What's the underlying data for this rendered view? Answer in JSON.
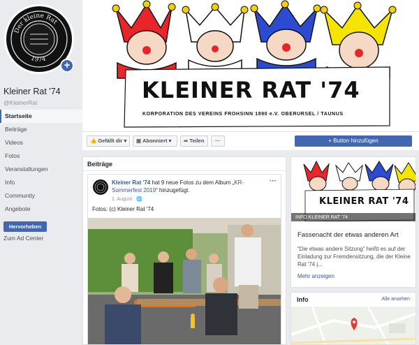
{
  "profile": {
    "name": "Kleiner Rat '74",
    "handle": "@KleinerRat",
    "avatar_text_top": "Der kleine Rat",
    "avatar_text_bottom": "1974"
  },
  "nav": {
    "items": [
      {
        "label": "Startseite",
        "active": true
      },
      {
        "label": "Beiträge"
      },
      {
        "label": "Videos"
      },
      {
        "label": "Fotos"
      },
      {
        "label": "Veranstaltungen"
      },
      {
        "label": "Info"
      },
      {
        "label": "Community"
      },
      {
        "label": "Angebote"
      }
    ],
    "promote_label": "Hervorheben",
    "ad_center_label": "Zum Ad Center"
  },
  "cover": {
    "title": "KLEINER RAT '74",
    "subtitle": "KORPORATION DES VEREINS FROHSINN 1890 e.V. OBERURSEL / TAUNUS"
  },
  "actions": {
    "liked": "Gefällt dir",
    "subscribed": "Abonniert",
    "share": "Teilen",
    "more": "···",
    "add_button": "Button hinzufügen"
  },
  "posts": {
    "header": "Beiträge",
    "post": {
      "author": "Kleiner Rat '74",
      "text_mid": " hat 9 neue Fotos zu dem Album „",
      "album": "KR-Sommerfest 2019",
      "text_end": "“ hinzugefügt.",
      "date": "1. August ·",
      "caption": "Fotos: (c) Kleiner Rat '74",
      "menu": "···"
    }
  },
  "event": {
    "image_title": "KLEINER RAT '74",
    "image_sub": "KORPORATION DES VEREINS FROHSINN 1890 e.V. OBERURSEL / TAUNUS",
    "overlay": "INFO KLEINER RAT '74",
    "title": "Fassenacht der etwas anderen Art",
    "description": "“Die etwas andere Sitzung” heißt es auf der Einladung zur Fremdensitzung, die der Kleine Rat '74 j...",
    "more": "Mehr anzeigen"
  },
  "info": {
    "header": "Info",
    "see_all": "Alle ansehen"
  },
  "colors": {
    "accent": "#4267b2",
    "link": "#365899",
    "background": "#e9ebee"
  }
}
